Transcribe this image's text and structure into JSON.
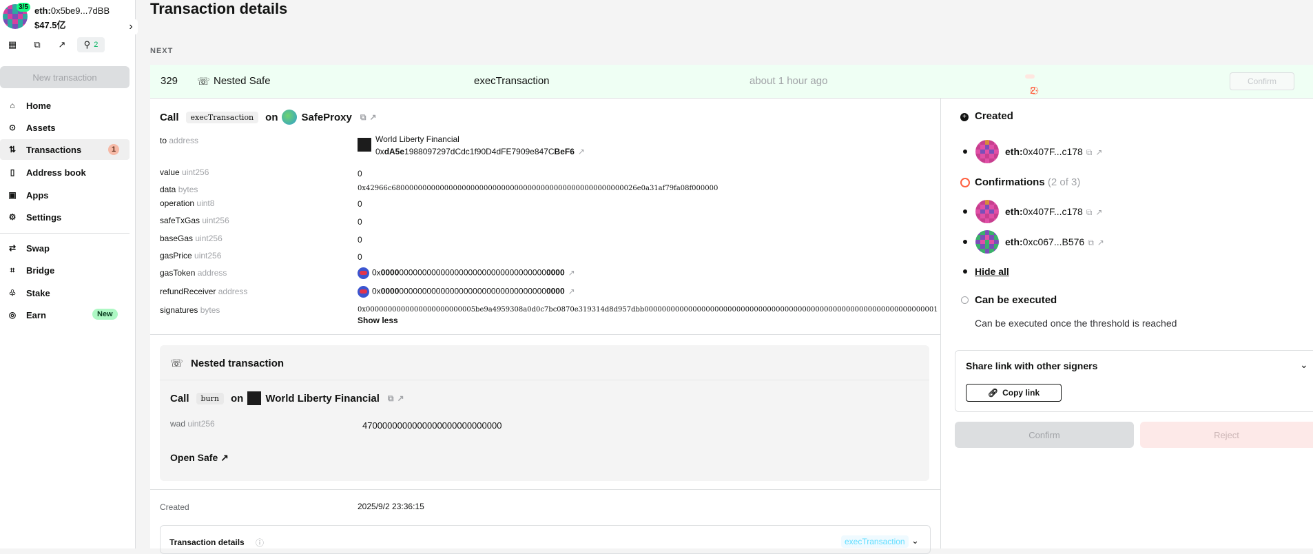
{
  "account": {
    "threshold": "3/5",
    "address_prefix": "eth:",
    "address": "0x5be9...7dBB",
    "balance": "$47.5亿"
  },
  "sidebar": {
    "quick_count": "2",
    "new_transaction": "New transaction",
    "items": [
      {
        "label": "Home",
        "icon": "home-icon"
      },
      {
        "label": "Assets",
        "icon": "assets-icon"
      },
      {
        "label": "Transactions",
        "icon": "transactions-icon",
        "badge": "1"
      },
      {
        "label": "Address book",
        "icon": "address-book-icon"
      },
      {
        "label": "Apps",
        "icon": "apps-icon"
      },
      {
        "label": "Settings",
        "icon": "settings-icon"
      },
      {
        "label": "Swap",
        "icon": "swap-icon"
      },
      {
        "label": "Bridge",
        "icon": "bridge-icon"
      },
      {
        "label": "Stake",
        "icon": "stake-icon"
      },
      {
        "label": "Earn",
        "icon": "earn-icon",
        "badge": "New"
      }
    ]
  },
  "page": {
    "title": "Transaction details",
    "section_label": "NEXT"
  },
  "tx": {
    "nonce": "329",
    "type": "Nested Safe",
    "method": "execTransaction",
    "time": "about 1 hour ago",
    "confirmations_badge": "2 out of 3",
    "confirm_button": "Confirm"
  },
  "call": {
    "prefix": "Call",
    "method": "execTransaction",
    "on": "on",
    "contract": "SafeProxy"
  },
  "params": [
    {
      "name": "to",
      "type": "address"
    },
    {
      "name": "value",
      "type": "uint256",
      "value": "0"
    },
    {
      "name": "data",
      "type": "bytes",
      "value": "0x42966c68000000000000000000000000000000000000000000000000000026e0a31af79fa08f000000"
    },
    {
      "name": "operation",
      "type": "uint8",
      "value": "0"
    },
    {
      "name": "safeTxGas",
      "type": "uint256",
      "value": "0"
    },
    {
      "name": "baseGas",
      "type": "uint256",
      "value": "0"
    },
    {
      "name": "gasPrice",
      "type": "uint256",
      "value": "0"
    },
    {
      "name": "gasToken",
      "type": "address"
    },
    {
      "name": "refundReceiver",
      "type": "address"
    },
    {
      "name": "signatures",
      "type": "bytes",
      "value": "0x0000000000000000000000005be9a4959308a0d0c7bc0870e319314d8d957dbb0000000000000000000000000000000000000000000000000000000000000000001"
    }
  ],
  "to_address": {
    "name": "World Liberty Financial",
    "pre": "0x",
    "bold_start": "dA5e",
    "middle": "1988097297dCdc1f90D4dFE7909e847C",
    "bold_end": "BeF6"
  },
  "zero_address": {
    "pre": "0x",
    "bold_start": "0000",
    "middle": "00000000000000000000000000000000",
    "bold_end": "0000"
  },
  "show_less": "Show less",
  "nested": {
    "title": "Nested transaction",
    "call_prefix": "Call",
    "method": "burn",
    "on": "on",
    "contract": "World Liberty Financial",
    "param_name": "wad",
    "param_type": "uint256",
    "param_value": "4700000000000000000000000000",
    "open_safe": "Open Safe"
  },
  "created": {
    "label": "Created",
    "value": "2025/9/2 23:36:15"
  },
  "details_section": {
    "label": "Transaction details",
    "tag": "execTransaction"
  },
  "status": {
    "created": "Created",
    "creator": {
      "prefix": "eth:",
      "addr": "0x407F...c178"
    },
    "confirmations_label": "Confirmations",
    "confirmations_count": "(2 of 3)",
    "signers": [
      {
        "prefix": "eth:",
        "addr": "0x407F...c178"
      },
      {
        "prefix": "eth:",
        "addr": "0xc067...B576"
      }
    ],
    "hide_all": "Hide all",
    "can_execute": "Can be executed",
    "can_execute_note": "Can be executed once the threshold is reached"
  },
  "share": {
    "title": "Share link with other signers",
    "copy_link": "Copy link"
  },
  "actions": {
    "confirm": "Confirm",
    "reject": "Reject"
  }
}
